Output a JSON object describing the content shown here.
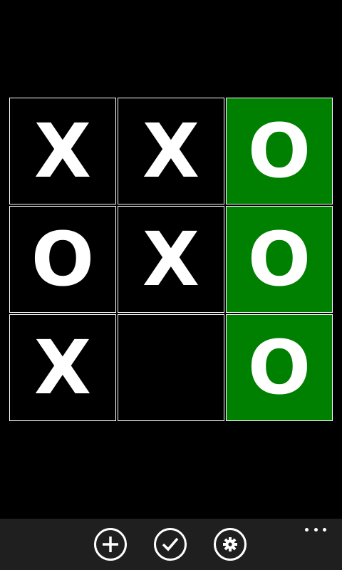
{
  "board": {
    "cells": [
      "X",
      "X",
      "O",
      "O",
      "X",
      "O",
      "X",
      "",
      "O"
    ],
    "winning_cells": [
      2,
      5,
      8
    ],
    "win_color": "#008000",
    "cell_color": "#000000",
    "mark_color": "#ffffff"
  },
  "app_bar": {
    "background": "#1f1f1f",
    "buttons": [
      {
        "icon": "plus-icon"
      },
      {
        "icon": "check-icon"
      },
      {
        "icon": "gear-icon"
      }
    ],
    "more_icon": "ellipsis-icon"
  }
}
